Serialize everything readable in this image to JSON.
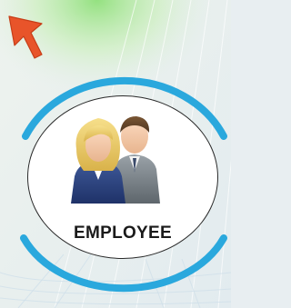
{
  "tile": {
    "label": "EMPLOYEE",
    "icon": "employees-icon"
  },
  "cursor": {
    "icon": "cursor-arrow-icon"
  },
  "colors": {
    "ring": "#2aa8dd",
    "cursor": "#e8542a",
    "background": "#e8eef1",
    "badge_border": "#2a2a2a",
    "label": "#1a1a1a"
  }
}
